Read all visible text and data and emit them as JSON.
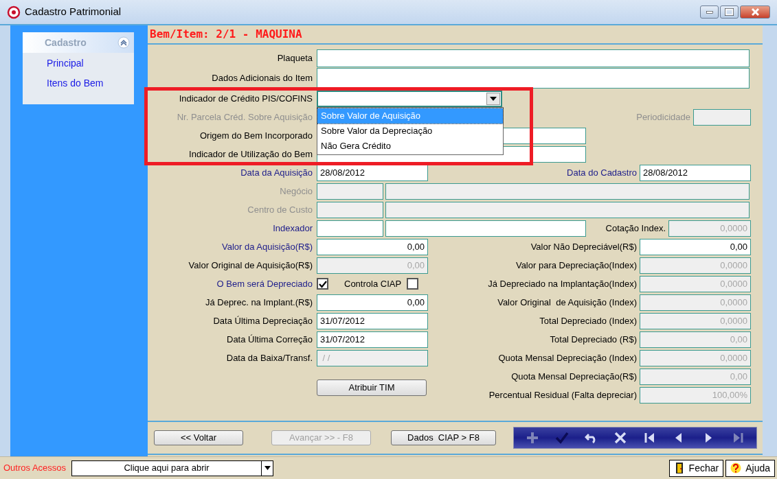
{
  "window": {
    "title": "Cadastro Patrimonial",
    "controls": [
      {
        "kind": "minimize"
      },
      {
        "kind": "maximize"
      },
      {
        "kind": "close"
      }
    ]
  },
  "sidebar": {
    "section": "Cadastro",
    "expanded": true,
    "items": [
      {
        "label": "Principal"
      },
      {
        "label": "Itens do Bem"
      }
    ]
  },
  "header": "Bem/Item: 2/1 - MAQUINA",
  "highlight_box": true,
  "rows": [
    {
      "left": {
        "label": "Plaqueta",
        "required": false,
        "disabled": false,
        "fields": [
          {
            "kind": "full",
            "disabled": false
          }
        ]
      }
    },
    {
      "left": {
        "label": "Dados Adicionais do Item",
        "required": false,
        "disabled": false,
        "fields": [
          {
            "kind": "memo",
            "disabled": false
          }
        ]
      }
    },
    {
      "left": {
        "label": "Indicador de Crédito PIS/COFINS",
        "required": false,
        "disabled": false,
        "fields": [
          {
            "kind": "combo",
            "disabled": false,
            "open": true,
            "options": [
              {
                "label": "Sobre Valor de Aquisição",
                "selected": true
              },
              {
                "label": "Sobre Valor da Depreciação",
                "selected": false
              },
              {
                "label": "Não Gera Crédito",
                "selected": false
              }
            ]
          }
        ]
      }
    },
    {
      "left": {
        "label": "Nr. Parcela Créd. Sobre Aquisição",
        "disabled": true
      },
      "right": {
        "label": "Periodicidade",
        "disabled": true,
        "field": {
          "kind": "tiny",
          "disabled": true
        }
      }
    },
    {
      "left": {
        "label": "Origem do Bem Incorporado",
        "required": false,
        "disabled": false,
        "fields": [
          {
            "kind": "medium",
            "disabled": false
          }
        ]
      }
    },
    {
      "left": {
        "label": "Indicador de Utilização do Bem",
        "required": false,
        "disabled": false,
        "fields": [
          {
            "kind": "medium",
            "disabled": false
          }
        ]
      }
    },
    {
      "left": {
        "label": "Data da Aquisição",
        "required": true,
        "disabled": false,
        "fields": [
          {
            "kind": "date",
            "value": "28/08/2012",
            "disabled": false
          }
        ]
      },
      "right": {
        "label": "Data do Cadastro",
        "required": true,
        "disabled": false,
        "field": {
          "kind": "date",
          "value": "28/08/2012",
          "disabled": false
        }
      }
    },
    {
      "left": {
        "label": "Negócio",
        "disabled": true,
        "fields": [
          {
            "kind": "code",
            "disabled": true
          },
          {
            "kind": "desc_long",
            "disabled": true
          }
        ]
      }
    },
    {
      "left": {
        "label": "Centro de Custo",
        "disabled": true,
        "fields": [
          {
            "kind": "code",
            "disabled": true
          },
          {
            "kind": "desc_long",
            "disabled": true
          }
        ]
      }
    },
    {
      "left": {
        "label": "Indexador",
        "required": true,
        "disabled": false,
        "fields": [
          {
            "kind": "code",
            "disabled": false
          },
          {
            "kind": "desc",
            "disabled": false
          }
        ]
      },
      "right": {
        "label": "Cotação Index.",
        "required": false,
        "disabled": false,
        "field": {
          "kind": "small",
          "value": "0,0000",
          "disabled": true
        }
      }
    },
    {
      "left": {
        "label": "Valor da Aquisição(R$)",
        "required": true,
        "disabled": false,
        "fields": [
          {
            "kind": "number",
            "value": "0,00",
            "disabled": false
          }
        ]
      },
      "right": {
        "label": "Valor Não Depreciável(R$)",
        "required": false,
        "disabled": false,
        "field": {
          "kind": "number",
          "value": "0,00",
          "disabled": false
        }
      }
    },
    {
      "left": {
        "label": "Valor Original de Aquisição(R$)",
        "required": false,
        "disabled": false,
        "fields": [
          {
            "kind": "number",
            "value": "0,00",
            "disabled": true
          }
        ]
      },
      "right": {
        "label": "Valor para Depreciação(Index)",
        "required": false,
        "disabled": false,
        "field": {
          "kind": "number",
          "value": "0,0000",
          "disabled": true
        }
      }
    },
    {
      "left": {
        "label": "O Bem será Depreciado",
        "required": true,
        "disabled": false,
        "fields": [
          {
            "kind": "check",
            "checked": true
          },
          {
            "kind": "check",
            "label": "Controla CIAP",
            "checked": false
          }
        ]
      },
      "right": {
        "label": "Já Depreciado na Implantação(Index)",
        "required": false,
        "disabled": false,
        "field": {
          "kind": "number",
          "value": "0,0000",
          "disabled": true
        }
      }
    },
    {
      "left": {
        "label": "Já Deprec. na Implant.(R$)",
        "required": false,
        "disabled": false,
        "fields": [
          {
            "kind": "number",
            "value": "0,00",
            "disabled": false
          }
        ]
      },
      "right": {
        "label": "Valor Original  de Aquisição (Index)",
        "required": false,
        "disabled": false,
        "field": {
          "kind": "number",
          "value": "0,0000",
          "disabled": true
        }
      }
    },
    {
      "left": {
        "label": "Data Última Depreciação",
        "required": false,
        "disabled": false,
        "fields": [
          {
            "kind": "date",
            "value": "31/07/2012",
            "disabled": false
          }
        ]
      },
      "right": {
        "label": "Total Depreciado (Index)",
        "required": false,
        "disabled": false,
        "field": {
          "kind": "number",
          "value": "0,0000",
          "disabled": true
        }
      }
    },
    {
      "left": {
        "label": "Data Última Correção",
        "required": false,
        "disabled": false,
        "fields": [
          {
            "kind": "date",
            "value": "31/07/2012",
            "disabled": false
          }
        ]
      },
      "right": {
        "label": "Total Depreciado (R$)",
        "required": false,
        "disabled": false,
        "field": {
          "kind": "number",
          "value": "0,00",
          "disabled": true
        }
      }
    },
    {
      "left": {
        "label": "Data da Baixa/Transf.",
        "required": false,
        "disabled": false,
        "fields": [
          {
            "kind": "date",
            "value": " / /",
            "disabled": true
          }
        ]
      },
      "right": {
        "label": "Quota Mensal Depreciação (Index)",
        "required": false,
        "disabled": false,
        "field": {
          "kind": "number",
          "value": "0,0000",
          "disabled": true
        }
      }
    },
    {
      "right": {
        "label": "Quota Mensal Depreciação(R$)",
        "required": false,
        "disabled": false,
        "field": {
          "kind": "number",
          "value": "0,00",
          "disabled": true
        }
      }
    },
    {
      "left": {
        "fields": [
          {
            "kind": "button",
            "label": "Atribuir TIM"
          }
        ]
      },
      "right": {
        "label": "Percentual Residual (Falta depreciar)",
        "required": false,
        "disabled": false,
        "field": {
          "kind": "number",
          "value": "100,00%",
          "disabled": true
        }
      }
    }
  ],
  "nav_buttons": [
    {
      "label": "<< Voltar",
      "disabled": false
    },
    {
      "label": "Avançar >> - F8",
      "disabled": true
    },
    {
      "label": "Dados  CIAP > F8",
      "disabled": false
    }
  ],
  "toolbar": [
    {
      "kind": "add",
      "disabled": true
    },
    {
      "kind": "confirm",
      "disabled": false
    },
    {
      "kind": "undo",
      "disabled": false
    },
    {
      "kind": "delete",
      "disabled": false
    },
    {
      "kind": "first",
      "disabled": false
    },
    {
      "kind": "previous",
      "disabled": false
    },
    {
      "kind": "next",
      "disabled": false
    },
    {
      "kind": "last",
      "disabled": true
    }
  ],
  "bottom_bar": {
    "label": "Outros Acessos",
    "combo": "Clique aqui para abrir",
    "buttons": [
      {
        "kind": "close",
        "label": "Fechar"
      },
      {
        "kind": "help",
        "label": "Ajuda"
      }
    ]
  }
}
